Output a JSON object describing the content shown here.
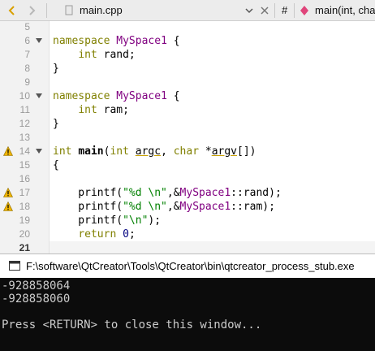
{
  "toolbar": {
    "file_name": "main.cpp",
    "hash_symbol": "#",
    "function_crumb": "main(int, char"
  },
  "editor": {
    "lines": [
      {
        "n": "5",
        "fold": false,
        "warn": false,
        "tokens": []
      },
      {
        "n": "6",
        "fold": true,
        "warn": false,
        "tokens": [
          [
            "kw",
            "namespace"
          ],
          [
            "p",
            " "
          ],
          [
            "ns",
            "MySpace1"
          ],
          [
            "p",
            " {"
          ]
        ]
      },
      {
        "n": "7",
        "fold": false,
        "warn": false,
        "tokens": [
          [
            "p",
            "    "
          ],
          [
            "kw",
            "int"
          ],
          [
            "p",
            " rand;"
          ]
        ]
      },
      {
        "n": "8",
        "fold": false,
        "warn": false,
        "tokens": [
          [
            "p",
            "}"
          ]
        ]
      },
      {
        "n": "9",
        "fold": false,
        "warn": false,
        "tokens": []
      },
      {
        "n": "10",
        "fold": true,
        "warn": false,
        "tokens": [
          [
            "kw",
            "namespace"
          ],
          [
            "p",
            " "
          ],
          [
            "ns",
            "MySpace1"
          ],
          [
            "p",
            " {"
          ]
        ]
      },
      {
        "n": "11",
        "fold": false,
        "warn": false,
        "tokens": [
          [
            "p",
            "    "
          ],
          [
            "kw",
            "int"
          ],
          [
            "p",
            " ram;"
          ]
        ]
      },
      {
        "n": "12",
        "fold": false,
        "warn": false,
        "tokens": [
          [
            "p",
            "}"
          ]
        ]
      },
      {
        "n": "13",
        "fold": false,
        "warn": false,
        "tokens": []
      },
      {
        "n": "14",
        "fold": true,
        "warn": true,
        "tokens": [
          [
            "kw",
            "int"
          ],
          [
            "p",
            " "
          ],
          [
            "fn",
            "main"
          ],
          [
            "p",
            "("
          ],
          [
            "kw",
            "int"
          ],
          [
            "p",
            " "
          ],
          [
            "ul",
            "argc"
          ],
          [
            "p",
            ", "
          ],
          [
            "kw",
            "char"
          ],
          [
            "p",
            " *"
          ],
          [
            "ul",
            "argv"
          ],
          [
            "p",
            "[])"
          ]
        ]
      },
      {
        "n": "15",
        "fold": false,
        "warn": false,
        "tokens": [
          [
            "p",
            "{"
          ]
        ]
      },
      {
        "n": "16",
        "fold": false,
        "warn": false,
        "tokens": []
      },
      {
        "n": "17",
        "fold": false,
        "warn": true,
        "tokens": [
          [
            "p",
            "    printf("
          ],
          [
            "str",
            "\"%d \\n\""
          ],
          [
            "p",
            ",&"
          ],
          [
            "ns",
            "MySpace1"
          ],
          [
            "p",
            "::rand);"
          ]
        ]
      },
      {
        "n": "18",
        "fold": false,
        "warn": true,
        "tokens": [
          [
            "p",
            "    printf("
          ],
          [
            "str",
            "\"%d \\n\""
          ],
          [
            "p",
            ",&"
          ],
          [
            "ns",
            "MySpace1"
          ],
          [
            "p",
            "::ram);"
          ]
        ]
      },
      {
        "n": "19",
        "fold": false,
        "warn": false,
        "tokens": [
          [
            "p",
            "    printf("
          ],
          [
            "str",
            "\"\\n\""
          ],
          [
            "p",
            ");"
          ]
        ]
      },
      {
        "n": "20",
        "fold": false,
        "warn": false,
        "tokens": [
          [
            "p",
            "    "
          ],
          [
            "kw",
            "return"
          ],
          [
            "p",
            " "
          ],
          [
            "num",
            "0"
          ],
          [
            "p",
            ";"
          ]
        ]
      },
      {
        "n": "21",
        "fold": false,
        "warn": false,
        "current": true,
        "tokens": []
      }
    ]
  },
  "console": {
    "title": "F:\\software\\QtCreator\\Tools\\QtCreator\\bin\\qtcreator_process_stub.exe",
    "output_lines": [
      "-928858064",
      "-928858060",
      "",
      "Press <RETURN> to close this window..."
    ]
  },
  "colors": {
    "keyword": "#808000",
    "namespace": "#800080",
    "string": "#008000",
    "number": "#000080",
    "warning": "#f0b400",
    "console_bg": "#0c0c0c"
  }
}
